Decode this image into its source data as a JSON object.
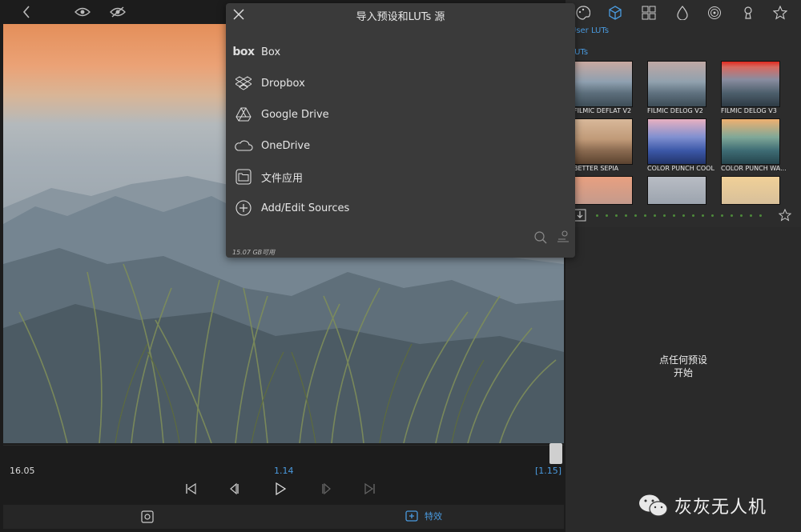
{
  "app": {
    "accent": "#4a9be0"
  },
  "modal": {
    "title": "导入预设和LUTs 源",
    "sources": [
      {
        "label": "Box",
        "icon": "box-logo-icon"
      },
      {
        "label": "Dropbox",
        "icon": "dropbox-icon"
      },
      {
        "label": "Google Drive",
        "icon": "google-drive-icon"
      },
      {
        "label": "OneDrive",
        "icon": "onedrive-icon"
      },
      {
        "label": "文件应用",
        "icon": "folder-icon"
      },
      {
        "label": "Add/Edit Sources",
        "icon": "plus-circle-icon"
      }
    ],
    "storage": "15.07 GB可用"
  },
  "timeline": {
    "current": "16.05",
    "middle": "1.14",
    "end": "[1.15]"
  },
  "bottom_bar": {
    "effects_label": "特效"
  },
  "right_panel": {
    "tabs": [
      "palette-icon",
      "cube-icon",
      "grid-icon",
      "drop-icon",
      "spiral-icon",
      "keyhole-icon",
      "star-icon"
    ],
    "user_luts_label": "User LUTs",
    "luts_label": "LUTs",
    "thumbnails": [
      {
        "label": "FILMIC DEFLAT V2"
      },
      {
        "label": "FILMIC DELOG V2"
      },
      {
        "label": "FILMIC DELOG V3"
      },
      {
        "label": "BETTER SEPIA"
      },
      {
        "label": "COLOR PUNCH COOL"
      },
      {
        "label": "COLOR PUNCH WA..."
      }
    ],
    "hint": "点任何预设\n开始"
  },
  "watermark": "灰灰无人机"
}
